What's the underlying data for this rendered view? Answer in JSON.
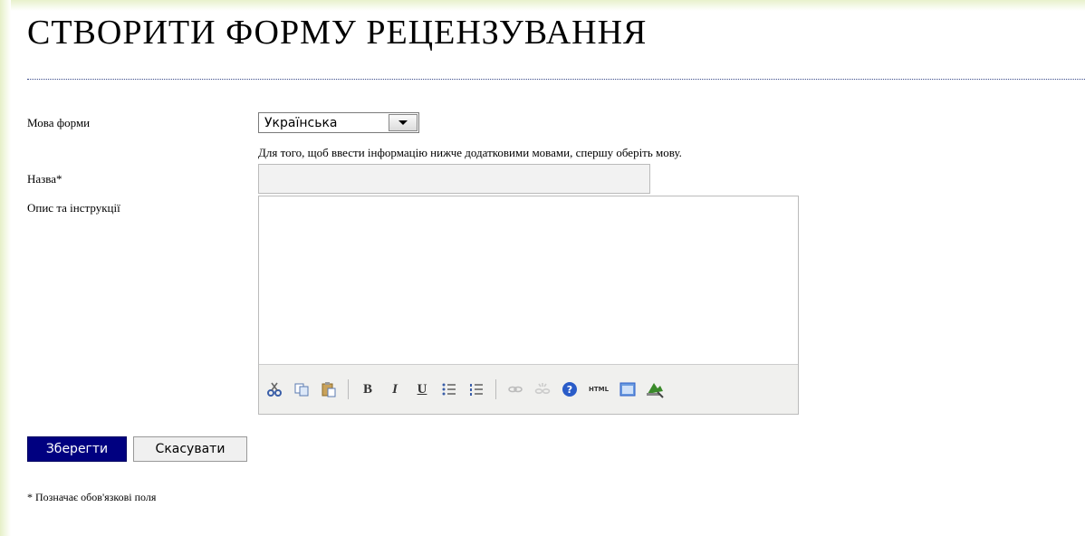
{
  "page": {
    "title": "СТВОРИТИ ФОРМУ РЕЦЕНЗУВАННЯ"
  },
  "form": {
    "language": {
      "label": "Мова форми",
      "selected": "Українська",
      "help": "Для того, щоб ввести інформацію нижче додатковими мовами, спершу оберіть мову."
    },
    "title_field": {
      "label": "Назва*",
      "value": ""
    },
    "description": {
      "label": "Опис та інструкції",
      "value": ""
    }
  },
  "editor_toolbar": {
    "icons": [
      "cut-icon",
      "copy-icon",
      "paste-icon",
      "bold-icon",
      "italic-icon",
      "underline-icon",
      "bullet-list-icon",
      "numbered-list-icon",
      "link-icon",
      "unlink-icon",
      "help-icon",
      "html-icon",
      "fullscreen-icon",
      "image-icon"
    ],
    "bold": "B",
    "italic": "I",
    "underline": "U",
    "html": "HTML"
  },
  "buttons": {
    "save": "Зберегти",
    "cancel": "Скасувати"
  },
  "footnote": "* Позначає обов'язкові поля"
}
